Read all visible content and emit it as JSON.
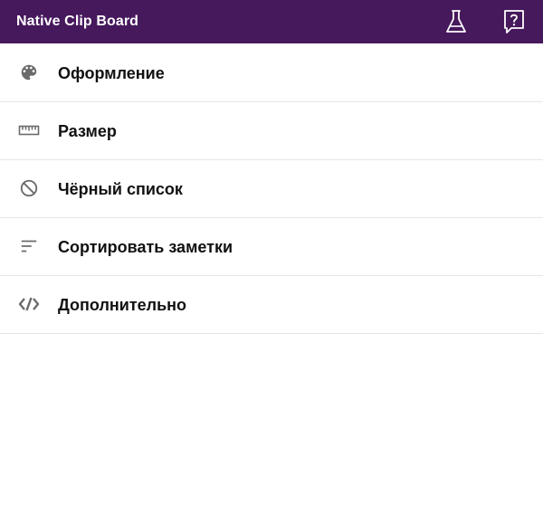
{
  "app_bar": {
    "title": "Native Clip Board",
    "background_color": "#46185c",
    "actions": [
      {
        "icon": "flask-icon"
      },
      {
        "icon": "help-icon"
      }
    ]
  },
  "menu": {
    "items": [
      {
        "label": "Оформление",
        "icon": "palette-icon"
      },
      {
        "label": "Размер",
        "icon": "ruler-icon"
      },
      {
        "label": "Чёрный список",
        "icon": "block-icon"
      },
      {
        "label": "Сортировать заметки",
        "icon": "sort-icon"
      },
      {
        "label": "Дополнительно",
        "icon": "code-icon"
      }
    ]
  }
}
